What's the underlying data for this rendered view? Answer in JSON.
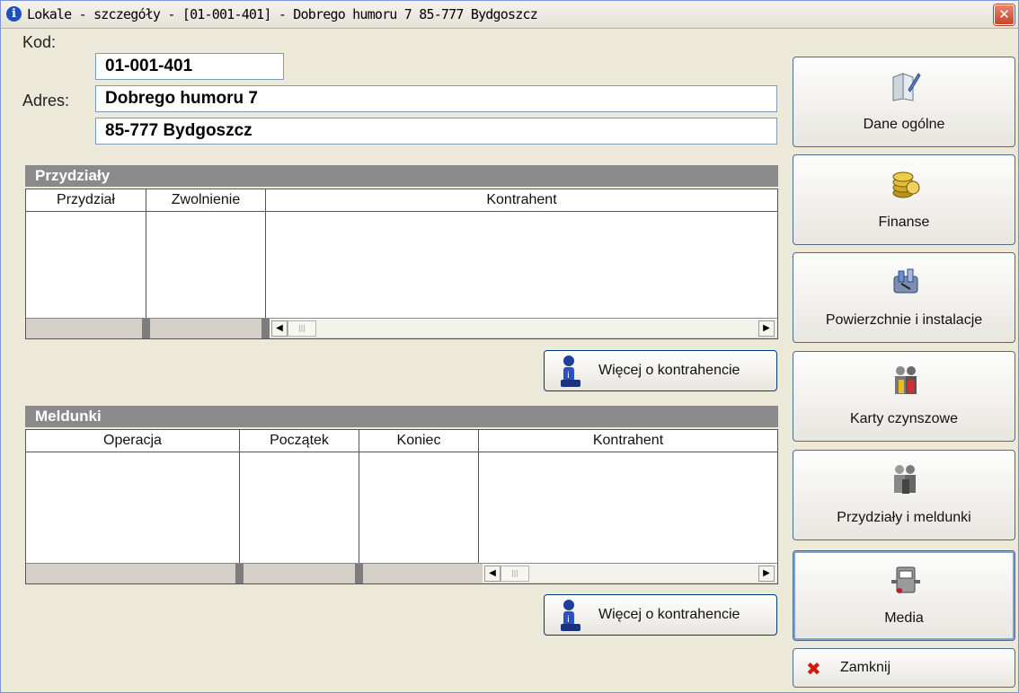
{
  "window": {
    "title": "Lokale - szczegóły - [01-001-401] - Dobrego humoru 7 85-777 Bydgoszcz",
    "close_glyph": "✕"
  },
  "form": {
    "kod_label": "Kod:",
    "kod_value": "01-001-401",
    "adres_label": "Adres:",
    "adres_line1": "Dobrego humoru 7",
    "adres_line2": "85-777 Bydgoszcz"
  },
  "przydzialy": {
    "title": "Przydziały",
    "columns": [
      "Przydział",
      "Zwolnienie",
      "Kontrahent"
    ],
    "rows": [],
    "more_button": "Więcej o kontrahencie"
  },
  "meldunki": {
    "title": "Meldunki",
    "columns": [
      "Operacja",
      "Początek",
      "Koniec",
      "Kontrahent"
    ],
    "rows": [],
    "more_button": "Więcej o kontrahencie"
  },
  "nav": [
    {
      "label": "Dane ogólne",
      "icon": "map-book-icon",
      "accent": "#5a7fc0"
    },
    {
      "label": "Finanse",
      "icon": "coins-icon",
      "accent": "#c8a020"
    },
    {
      "label": "Powierzchnie i instalacje",
      "icon": "tools-icon",
      "accent": "#6a8fcf"
    },
    {
      "label": "Karty czynszowe",
      "icon": "people-cards-icon",
      "accent": "#d03030"
    },
    {
      "label": "Przydziały i meldunki",
      "icon": "people-gray-icon",
      "accent": "#777777"
    },
    {
      "label": "Media",
      "icon": "meter-icon",
      "accent": "#7f7f7f"
    }
  ],
  "close_button": {
    "label": "Zamknij",
    "icon": "close-x-icon",
    "color": "#d21a0f"
  }
}
